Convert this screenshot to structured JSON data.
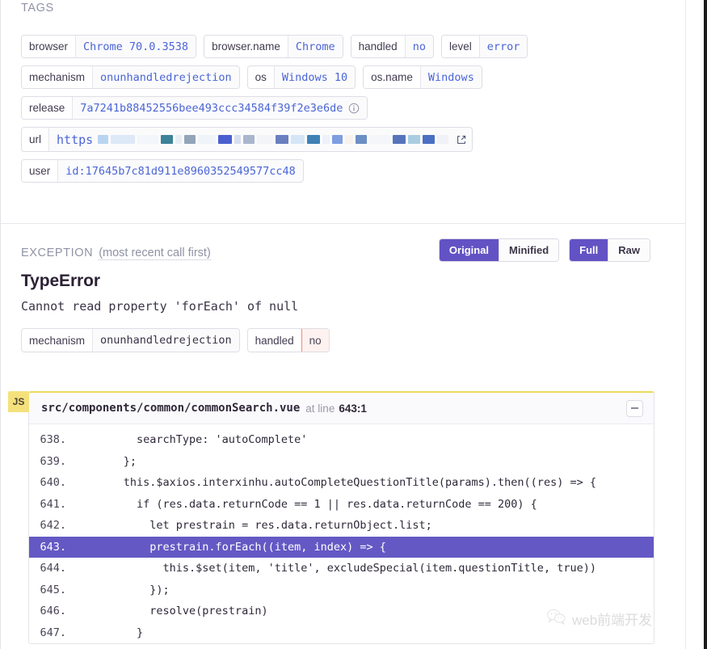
{
  "colors": {
    "accent": "#6252c4",
    "tag_value_blue": "#4b65d6",
    "danger_border": "#ef8a79",
    "danger_bg": "#fdf2f0",
    "js_badge_bg": "#f5e17c",
    "highlight_row": "#6459c4",
    "muted_text": "#9093a5"
  },
  "tags": {
    "heading": "TAGS",
    "rows": [
      [
        {
          "key": "browser",
          "value": "Chrome 70.0.3538"
        },
        {
          "key": "browser.name",
          "value": "Chrome"
        },
        {
          "key": "handled",
          "value": "no"
        },
        {
          "key": "level",
          "value": "error"
        }
      ],
      [
        {
          "key": "mechanism",
          "value": "onunhandledrejection"
        },
        {
          "key": "os",
          "value": "Windows 10"
        },
        {
          "key": "os.name",
          "value": "Windows"
        }
      ],
      [
        {
          "key": "release",
          "value": "7a7241b88452556bee493ccc34584f39f2e3e6de",
          "icon": "info-circle-icon"
        }
      ],
      [
        {
          "key": "url",
          "value": "https",
          "redacted": true,
          "icon": "external-link-icon"
        }
      ],
      [
        {
          "key": "user",
          "value": "id:17645b7c81d911e8960352549577cc48"
        }
      ]
    ]
  },
  "exception": {
    "heading": "EXCEPTION",
    "subheading": "(most recent call first)",
    "toggles": [
      {
        "name": "source-map-toggle",
        "options": [
          {
            "label": "Original",
            "active": true
          },
          {
            "label": "Minified",
            "active": false
          }
        ]
      },
      {
        "name": "stacktrace-detail-toggle",
        "options": [
          {
            "label": "Full",
            "active": true
          },
          {
            "label": "Raw",
            "active": false
          }
        ]
      }
    ],
    "error_type": "TypeError",
    "error_message": "Cannot read property 'forEach' of null",
    "tags": [
      {
        "key": "mechanism",
        "value": "onunhandledrejection"
      },
      {
        "key": "handled",
        "value": "no",
        "danger": true
      }
    ]
  },
  "frame": {
    "badge": "JS",
    "filename": "src/components/common/commonSearch.vue",
    "at_line_label": "at line",
    "line_ref": "643:1",
    "collapse_icon": "minus-icon",
    "lines": [
      {
        "number": "638.",
        "code": "        searchType: 'autoComplete'",
        "highlight": false
      },
      {
        "number": "639.",
        "code": "      };",
        "highlight": false
      },
      {
        "number": "640.",
        "code": "      this.$axios.interxinhu.autoCompleteQuestionTitle(params).then((res) => {",
        "highlight": false
      },
      {
        "number": "641.",
        "code": "        if (res.data.returnCode == 1 || res.data.returnCode == 200) {",
        "highlight": false
      },
      {
        "number": "642.",
        "code": "          let prestrain = res.data.returnObject.list;",
        "highlight": false
      },
      {
        "number": "643.",
        "code": "          prestrain.forEach((item, index) => {",
        "highlight": true
      },
      {
        "number": "644.",
        "code": "            this.$set(item, 'title', excludeSpecial(item.questionTitle, true))",
        "highlight": false
      },
      {
        "number": "645.",
        "code": "          });",
        "highlight": false
      },
      {
        "number": "646.",
        "code": "          resolve(prestrain)",
        "highlight": false
      },
      {
        "number": "647.",
        "code": "        }",
        "highlight": false
      }
    ]
  },
  "watermark": {
    "icon": "wechat-icon",
    "text": "web前端开发"
  }
}
